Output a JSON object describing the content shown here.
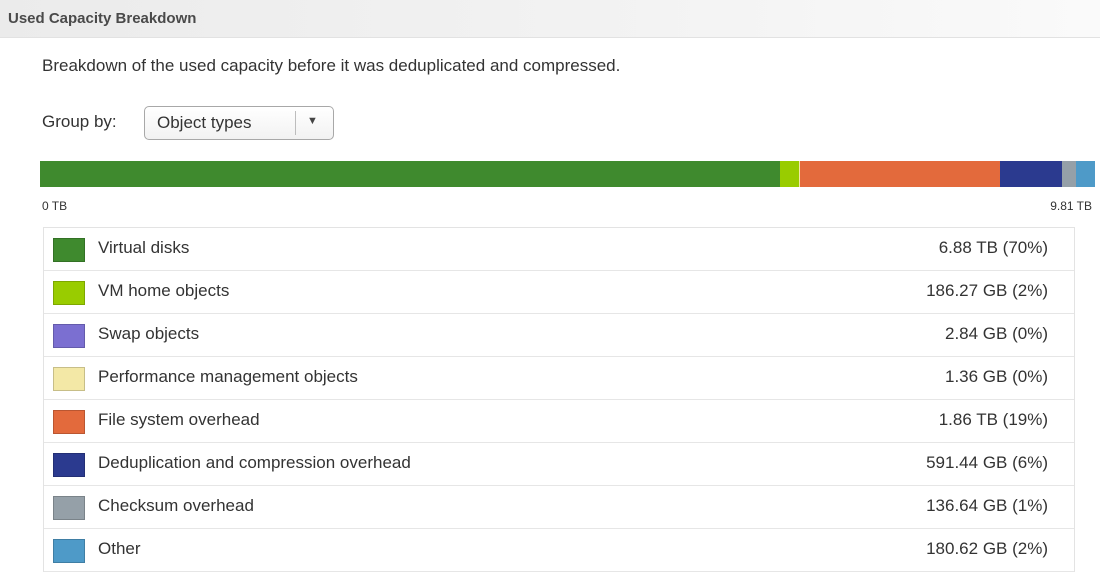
{
  "header": {
    "title": "Used Capacity Breakdown"
  },
  "description": "Breakdown of the used capacity before it was deduplicated and compressed.",
  "group_by": {
    "label": "Group by:",
    "selected": "Object types"
  },
  "axis": {
    "min_label": "0 TB",
    "max_label": "9.81 TB"
  },
  "legend": [
    {
      "label": "Virtual disks",
      "value": "6.88 TB (70%)",
      "color": "#3f8a2e"
    },
    {
      "label": "VM home objects",
      "value": "186.27 GB (2%)",
      "color": "#99cc00"
    },
    {
      "label": "Swap objects",
      "value": "2.84 GB (0%)",
      "color": "#7b6fd1"
    },
    {
      "label": "Performance management objects",
      "value": "1.36 GB (0%)",
      "color": "#f3e8a6"
    },
    {
      "label": "File system overhead",
      "value": "1.86 TB (19%)",
      "color": "#e36a3c"
    },
    {
      "label": "Deduplication and compression overhead",
      "value": "591.44 GB (6%)",
      "color": "#2b3a8f"
    },
    {
      "label": "Checksum overhead",
      "value": "136.64 GB (1%)",
      "color": "#95a0a8"
    },
    {
      "label": "Other",
      "value": "180.62 GB (2%)",
      "color": "#4e9ac8"
    }
  ],
  "capacity_bar": {
    "total_tb": 9.81,
    "segments": [
      {
        "name": "Virtual disks",
        "value_tb": 6.88,
        "color": "#3f8a2e"
      },
      {
        "name": "VM home objects",
        "value_tb": 0.1819,
        "color": "#99cc00"
      },
      {
        "name": "Swap objects",
        "value_tb": 0.0028,
        "color": "#7b6fd1"
      },
      {
        "name": "Performance management objects",
        "value_tb": 0.0013,
        "color": "#f3e8a6"
      },
      {
        "name": "File system overhead",
        "value_tb": 1.86,
        "color": "#e36a3c"
      },
      {
        "name": "Deduplication and compression overhead",
        "value_tb": 0.5776,
        "color": "#2b3a8f"
      },
      {
        "name": "Checksum overhead",
        "value_tb": 0.1334,
        "color": "#95a0a8"
      },
      {
        "name": "Other",
        "value_tb": 0.1764,
        "color": "#4e9ac8"
      }
    ]
  }
}
